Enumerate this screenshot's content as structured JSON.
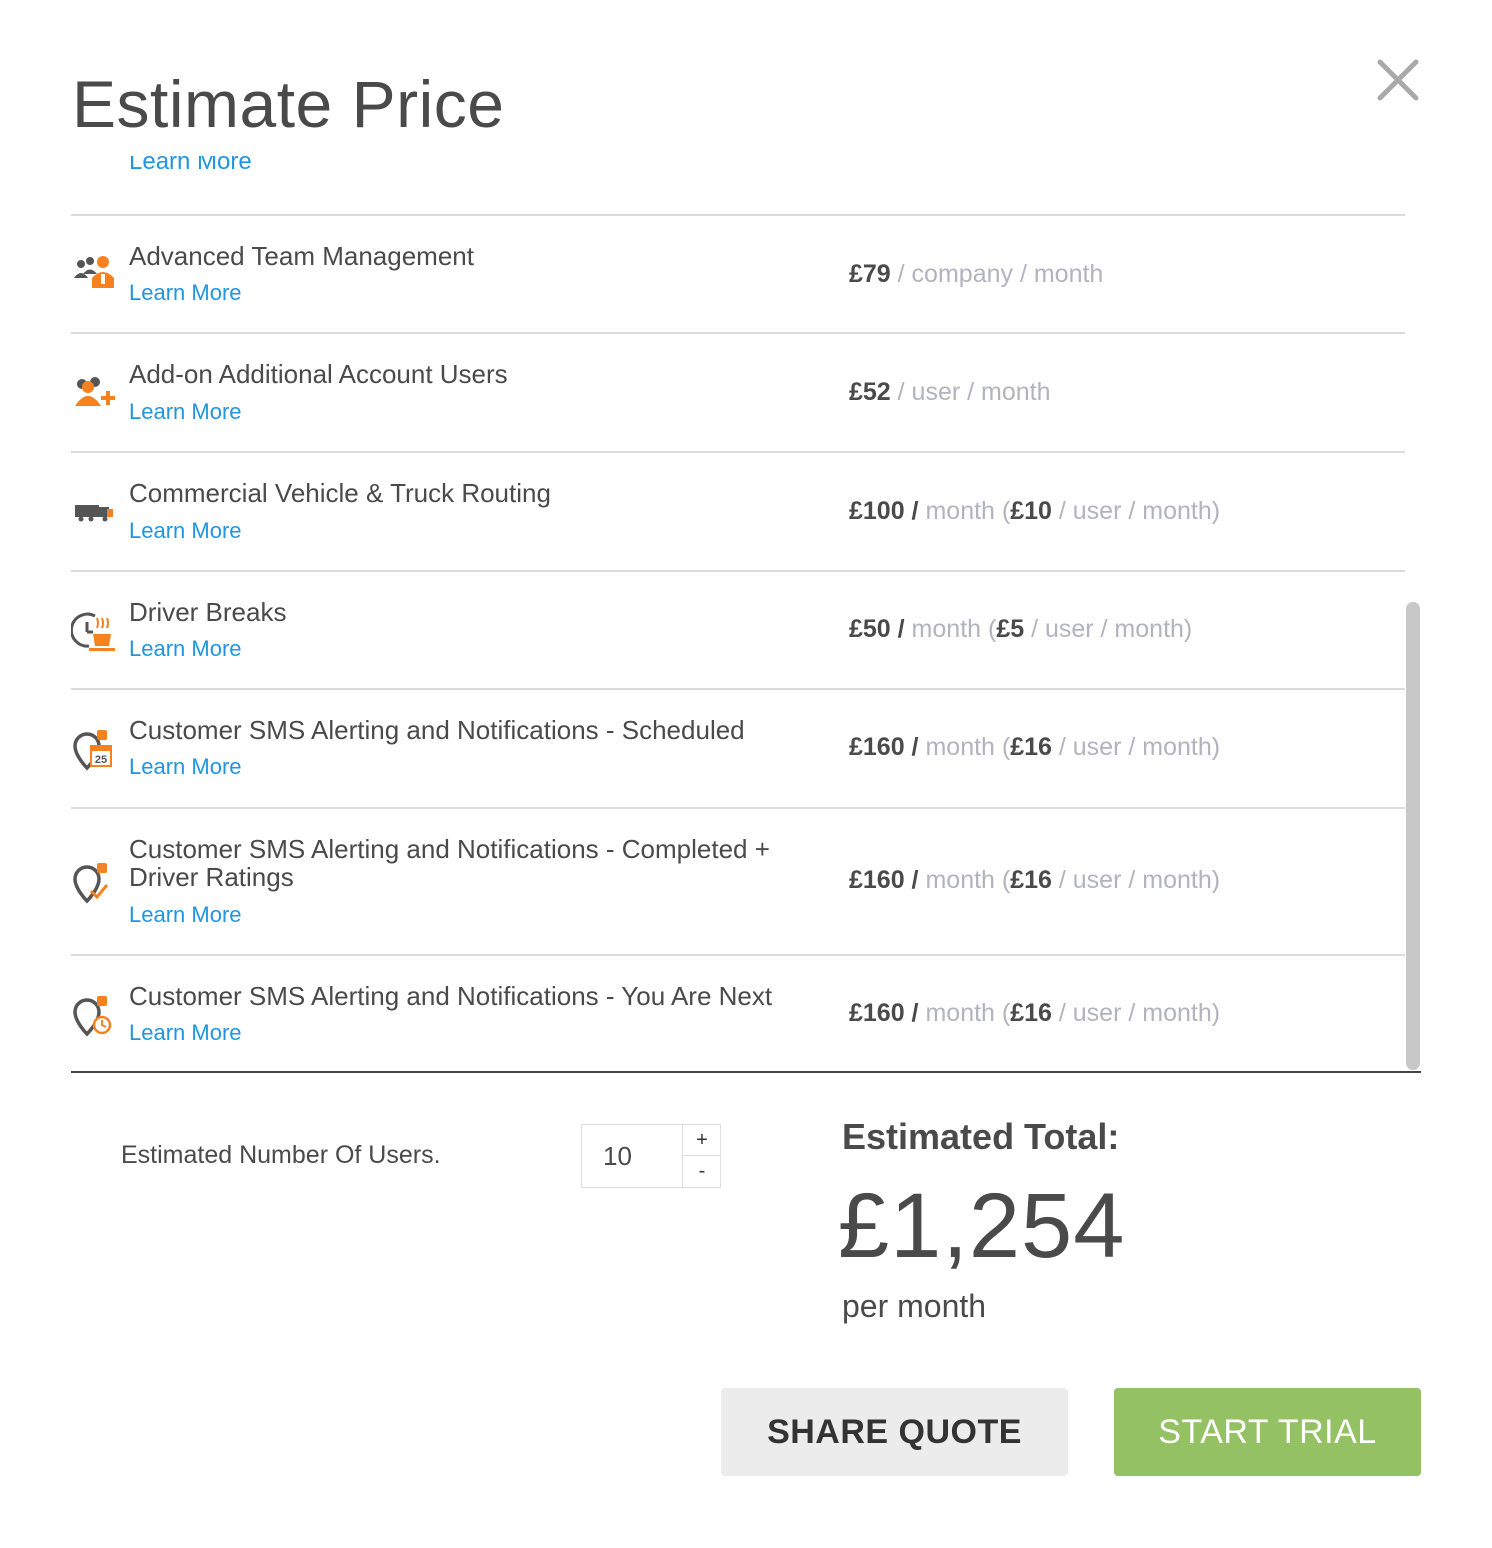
{
  "modal": {
    "title": "Estimate Price",
    "close_icon": "close-icon"
  },
  "colors": {
    "accent_orange": "#f5821f",
    "link_blue": "#2196e0",
    "trial_green": "#95c165",
    "price_muted": "#b3b3bd",
    "text_dark": "#4a4a4a"
  },
  "list": {
    "clipped_learn_more": "Learn More",
    "items": [
      {
        "name": "Advanced Team Management",
        "learn_more": "Learn More",
        "icon": "team-management-icon",
        "price_amount": "£79",
        "price_unit": " / company / month"
      },
      {
        "name": "Add-on Additional Account Users",
        "learn_more": "Learn More",
        "icon": "add-users-icon",
        "price_amount": "£52",
        "price_unit": " / user / month"
      },
      {
        "name": "Commercial Vehicle & Truck Routing",
        "learn_more": "Learn More",
        "icon": "truck-icon",
        "price_amount": "£100 /",
        "price_unit": " month (",
        "price_amount2": "£10",
        "price_unit2": " / user / month)"
      },
      {
        "name": "Driver Breaks",
        "learn_more": "Learn More",
        "icon": "coffee-break-icon",
        "price_amount": "£50 /",
        "price_unit": " month (",
        "price_amount2": "£5",
        "price_unit2": " / user / month)"
      },
      {
        "name": "Customer SMS Alerting and Notifications - Scheduled",
        "learn_more": "Learn More",
        "icon": "sms-scheduled-icon",
        "icon_text": "25",
        "price_amount": "£160 /",
        "price_unit": " month (",
        "price_amount2": "£16",
        "price_unit2": " / user / month)"
      },
      {
        "name": "Customer SMS Alerting and Notifications - Completed + Driver Ratings",
        "learn_more": "Learn More",
        "icon": "sms-completed-icon",
        "price_amount": "£160 /",
        "price_unit": " month (",
        "price_amount2": "£16",
        "price_unit2": " / user / month)"
      },
      {
        "name": "Customer SMS Alerting and Notifications - You Are Next",
        "learn_more": "Learn More",
        "icon": "sms-you-are-next-icon",
        "price_amount": "£160 /",
        "price_unit": " month (",
        "price_amount2": "£16",
        "price_unit2": " / user / month)"
      }
    ]
  },
  "users": {
    "label": "Estimated Number Of Users.",
    "value": "10",
    "plus": "+",
    "minus": "-"
  },
  "total": {
    "label": "Estimated Total:",
    "amount": "£1,254",
    "period": "per month"
  },
  "actions": {
    "share_label": "SHARE QUOTE",
    "trial_label": "START TRIAL"
  }
}
